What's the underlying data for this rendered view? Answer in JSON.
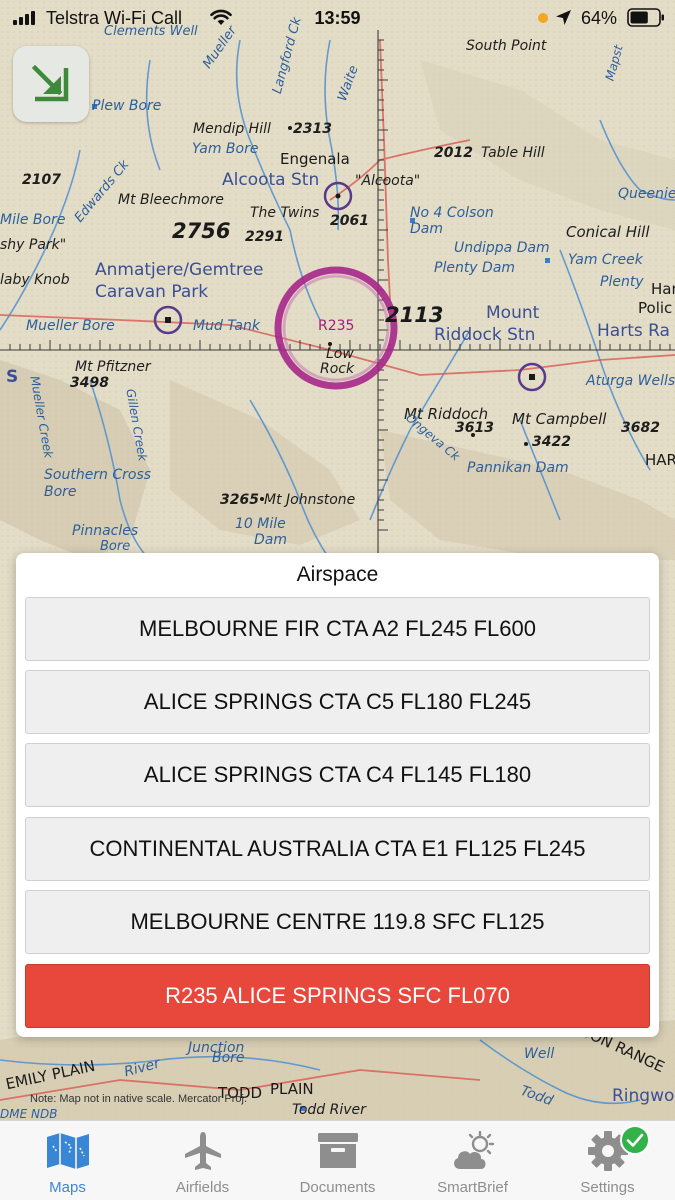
{
  "status_bar": {
    "carrier": "Telstra Wi-Fi Call",
    "time": "13:59",
    "battery": "64%",
    "battery_level": 0.64
  },
  "map": {
    "labels": {
      "clements_well": "Clements Well",
      "south_point": "South Point",
      "mueller": "Mueller",
      "langford_ck": "Langford Ck",
      "waite": "Waite",
      "mapstone": "Mapst",
      "plew_bore": "Plew Bore",
      "mendip_hill": "Mendip Hill",
      "mendip_elev": "2313",
      "yam_bore": "Yam Bore",
      "engenala": "Engenala",
      "table_hill_elev": "2012",
      "table_hill": "Table Hill",
      "elev_2107": "2107",
      "edwards_ck": "Edwards Ck",
      "alcoota_stn": "Alcoota Stn",
      "alcoota_q": "\"Alcoota\"",
      "queenie": "Queenie",
      "mt_bleechmore": "Mt Bleechmore",
      "the_twins": "The Twins",
      "elev_2061": "2061",
      "no4_colson": "No 4 Colson",
      "dam": "Dam",
      "mile_bore": "Mile Bore",
      "elev_2756": "2756",
      "elev_2291": "2291",
      "conical_hill": "Conical Hill",
      "shy_park": "shy Park\"",
      "undippa_dam": "Undippa Dam",
      "plenty_dam": "Plenty Dam",
      "yam_creek": "Yam Creek",
      "anmatjere": "Anmatjere/Gemtree",
      "caravan_park": "Caravan Park",
      "laby_knob": "laby Knob",
      "plenty": "Plenty",
      "har": "Har",
      "polic": "Polic",
      "harts_ra": "Harts Ra",
      "mueller_bore": "Mueller Bore",
      "mud_tank": "Mud Tank",
      "r235": "R235",
      "elev_2113": "2113",
      "mount": "Mount",
      "riddock_stn": "Riddock Stn",
      "low": "Low",
      "rock": "Rock",
      "mt_pfitzner": "Mt Pfitzner",
      "elev_3498": "3498",
      "s": "S",
      "aturga_wells": "Aturga Wells",
      "mueller_creek": "Mueller Creek",
      "gillen_creek": "Gillen Creek",
      "mt_riddoch": "Mt Riddoch",
      "elev_3613": "3613",
      "mt_campbell": "Mt Campbell",
      "elev_3682": "3682",
      "elev_3422": "3422",
      "ongeva_ck": "Ongeva Ck",
      "southern_cross": "Southern Cross",
      "bore": "Bore",
      "pannikan_dam": "Pannikan Dam",
      "har2": "HAR",
      "elev_3265": "3265",
      "mt_johnstone": "Mt Johnstone",
      "ten_mile": "10 Mile",
      "dam2": "Dam",
      "pinnacles": "Pinnacles",
      "bore2": "Bore",
      "emily_plain": "EMILY PLAIN",
      "river": "River",
      "junction": "Junction",
      "bore3": "Bore",
      "todd": "TODD",
      "plain": "PLAIN",
      "todd_river": "Todd River",
      "todd2": "Todd",
      "well": "Well",
      "son_range": "SON RANGE",
      "ringwo": "Ringwo",
      "dme_ndb": "DME NDB"
    },
    "note": "Note: Map not in native scale. Mercator Proj."
  },
  "map_mode_button": {
    "icon": "arrow-down-right-icon"
  },
  "airspace": {
    "title": "Airspace",
    "items": [
      {
        "label": "MELBOURNE FIR CTA A2 FL245 FL600",
        "selected": false
      },
      {
        "label": "ALICE SPRINGS CTA C5 FL180 FL245",
        "selected": false
      },
      {
        "label": "ALICE SPRINGS CTA C4 FL145 FL180",
        "selected": false
      },
      {
        "label": "CONTINENTAL AUSTRALIA CTA E1 FL125 FL245",
        "selected": false
      },
      {
        "label": "MELBOURNE CENTRE 119.8 SFC FL125",
        "selected": false
      },
      {
        "label": "R235 ALICE SPRINGS SFC FL070",
        "selected": true
      }
    ],
    "selected_color": "#e8473b"
  },
  "tab_bar": {
    "tabs": [
      {
        "label": "Maps",
        "icon": "map-icon",
        "active": true
      },
      {
        "label": "Airfields",
        "icon": "airplane-icon",
        "active": false
      },
      {
        "label": "Documents",
        "icon": "archive-box-icon",
        "active": false
      },
      {
        "label": "SmartBrief",
        "icon": "weather-icon",
        "active": false
      },
      {
        "label": "Settings",
        "icon": "gear-icon",
        "active": false,
        "badge": "check"
      }
    ],
    "active_color": "#3a86d6",
    "badge_color": "#34b24a"
  }
}
